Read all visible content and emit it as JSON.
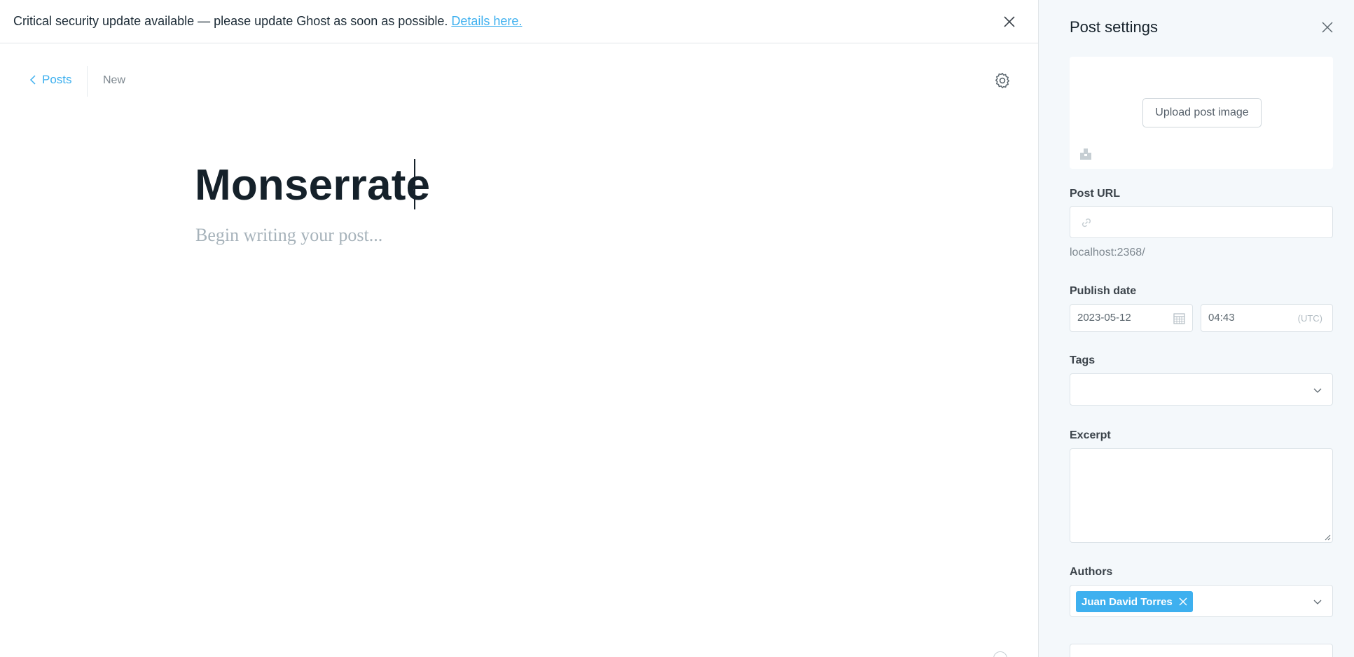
{
  "banner": {
    "message": "Critical security update available — please update Ghost as soon as possible.",
    "link_text": "Details here."
  },
  "nav": {
    "back_label": "Posts",
    "status": "New"
  },
  "post": {
    "title": "Monserrate",
    "body_placeholder": "Begin writing your post..."
  },
  "settings": {
    "title": "Post settings",
    "upload_label": "Upload post image",
    "url_label": "Post URL",
    "url_value": "",
    "url_preview": "localhost:2368/",
    "publish_label": "Publish date",
    "date_value": "2023-05-12",
    "time_value": "04:43",
    "timezone": "(UTC)",
    "tags_label": "Tags",
    "excerpt_label": "Excerpt",
    "authors_label": "Authors",
    "authors": [
      "Juan David Torres"
    ]
  },
  "colors": {
    "accent": "#3eb0ef",
    "text": "#15212a",
    "muted": "#7d878f",
    "panel_bg": "#f4f8fb"
  },
  "icons": {
    "banner_close": "close-icon",
    "back": "chevron-left-icon",
    "settings": "gear-icon",
    "panel_close": "close-icon",
    "image": "image-icon",
    "url": "link-icon",
    "calendar": "calendar-icon",
    "select": "chevron-down-icon",
    "author_remove": "close-icon"
  }
}
